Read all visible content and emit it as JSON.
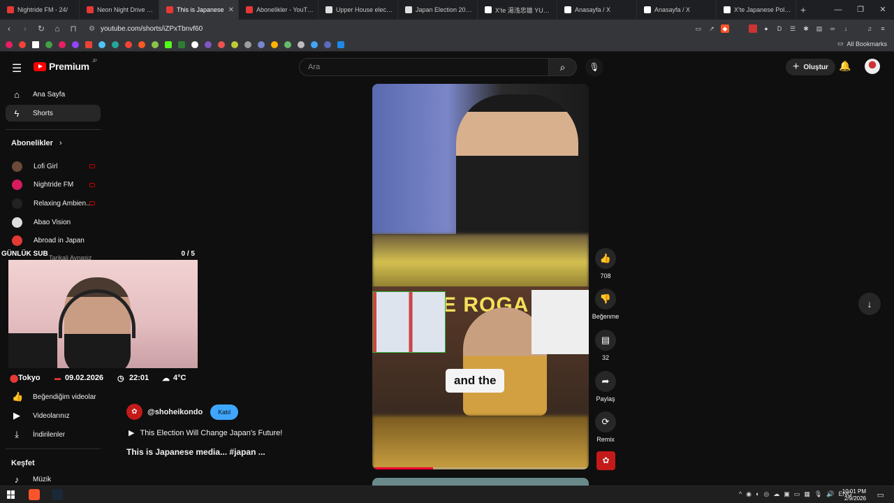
{
  "browser": {
    "tabs": [
      {
        "title": "Nightride FM - 24/",
        "color": "#e53935"
      },
      {
        "title": "Neon Night Drive in To",
        "color": "#e53935"
      },
      {
        "title": "This is Japanese",
        "color": "#e53935",
        "active": true
      },
      {
        "title": "Abonelikler - YouTube",
        "color": "#e53935"
      },
      {
        "title": "Upper House election",
        "color": "#e0e0e0"
      },
      {
        "title": "Japan Election 2026: L",
        "color": "#e0e0e0"
      },
      {
        "title": "X'te 湯浅忠雄 YUASA",
        "color": "#ffffff"
      },
      {
        "title": "Anasayfa / X",
        "color": "#ffffff"
      },
      {
        "title": "Anasayfa / X",
        "color": "#ffffff"
      },
      {
        "title": "X'te Japanese Politics",
        "color": "#ffffff"
      }
    ],
    "new_tab": "+",
    "window_controls": [
      "—",
      "❐",
      "✕"
    ],
    "url": "youtube.com/shorts/iZPxTbnvf60",
    "all_bookmarks": "All Bookmarks"
  },
  "youtube": {
    "logo_text": "Premium",
    "logo_region": "JP",
    "search_placeholder": "Ara",
    "create_label": "Oluştur",
    "icons": {
      "menu": "hamburger-icon",
      "search": "search-icon",
      "mic": "mic-icon",
      "bell": "bell-icon"
    }
  },
  "sidebar": {
    "home": "Ana Sayfa",
    "shorts": "Shorts",
    "subscriptions_header": "Abonelikler",
    "subscriptions": [
      {
        "name": "Lofi Girl",
        "live": true,
        "color": "#6b4a3a"
      },
      {
        "name": "Nightride FM",
        "live": true,
        "color": "#d81b60"
      },
      {
        "name": "Relaxing Ambien...",
        "live": true,
        "color": "#222222"
      },
      {
        "name": "Abao Vision",
        "live": false,
        "color": "#dddddd"
      },
      {
        "name": "Abroad in Japan",
        "live": false,
        "color": "#e53935"
      }
    ],
    "partial_item": "Tarikali Aynasiz",
    "liked": "Beğendiğim videolar",
    "your_videos": "Videolarınız",
    "downloads": "İndirilenler",
    "explore_header": "Keşfet",
    "music": "Müzik"
  },
  "overlay": {
    "sub_label": "GÜNLÜK SUB",
    "sub_count": "0 / 5",
    "city": "Tokyo",
    "date": "09.02.2026",
    "time": "22:01",
    "temp": "4°C"
  },
  "short": {
    "caption": "and the",
    "sign_text": "E ROGA",
    "progress_fraction": 0.28,
    "likes": "708",
    "dislike_label": "Beğenme",
    "comments": "32",
    "share_label": "Paylaş",
    "remix_label": "Remix",
    "channel": "@shoheikondo",
    "join_label": "Katıl",
    "song": "This Election Will Change Japan's Future!",
    "title": "This is Japanese media... #japan ..."
  },
  "taskbar": {
    "lang": "ENG",
    "time": "10:01 PM",
    "date": "2/9/2026"
  }
}
